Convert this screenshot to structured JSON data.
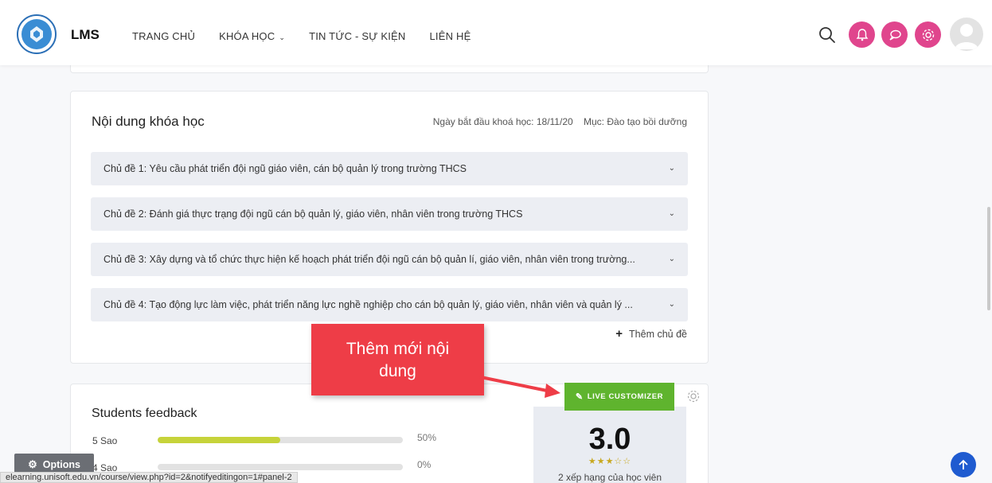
{
  "header": {
    "brand": "LMS",
    "nav": [
      {
        "label": "TRANG CHỦ",
        "has_dropdown": false
      },
      {
        "label": "KHÓA HỌC",
        "has_dropdown": true
      },
      {
        "label": "TIN TỨC - SỰ KIỆN",
        "has_dropdown": false
      },
      {
        "label": "LIÊN HỆ",
        "has_dropdown": false
      }
    ],
    "icons": [
      "search-icon",
      "notification-bell-icon",
      "messages-icon",
      "settings-icon",
      "user-avatar"
    ],
    "accent_color": "#e0458d"
  },
  "course_content": {
    "title": "Nội dung khóa học",
    "start_date": "Ngày bắt đầu khoá học: 18/11/20",
    "category": "Mục: Đào tạo bồi dưỡng",
    "topics": [
      "Chủ đề 1: Yêu cầu phát triển đội ngũ giáo viên, cán bộ quản lý trong trường THCS",
      "Chủ đề 2: Đánh giá thực trạng đội ngũ cán bộ quản lý, giáo viên, nhân viên trong trường THCS",
      "Chủ đề 3: Xây dựng và tổ chức thực hiện kế hoạch phát triển đội ngũ cán bộ quản lí, giáo viên, nhân viên trong trường...",
      "Chủ đề 4: Tạo động lực làm việc, phát triển năng lực nghề nghiệp cho cán bộ quản lý, giáo viên, nhân viên và quản lý ..."
    ],
    "add_topic_label": "Thêm chủ đề"
  },
  "callout": {
    "text_line1": "Thêm mới nội",
    "text_line2": "dung",
    "color": "#ee3d47"
  },
  "live_customizer": {
    "label": "LIVE CUSTOMIZER",
    "color": "#5fb42e"
  },
  "feedback": {
    "title": "Students feedback",
    "rows": [
      {
        "label": "5 Sao",
        "percent_text": "50%",
        "fill": 0.5
      },
      {
        "label": "4 Sao",
        "percent_text": "0%",
        "fill": 0
      }
    ],
    "rating_value": "3.0",
    "rating_stars": "★★★☆☆",
    "rating_count": "2 xếp hạng của học viên"
  },
  "options": {
    "label": "Options"
  },
  "status_url": "elearning.unisoft.edu.vn/course/view.php?id=2&notifyeditingon=1#panel-2"
}
